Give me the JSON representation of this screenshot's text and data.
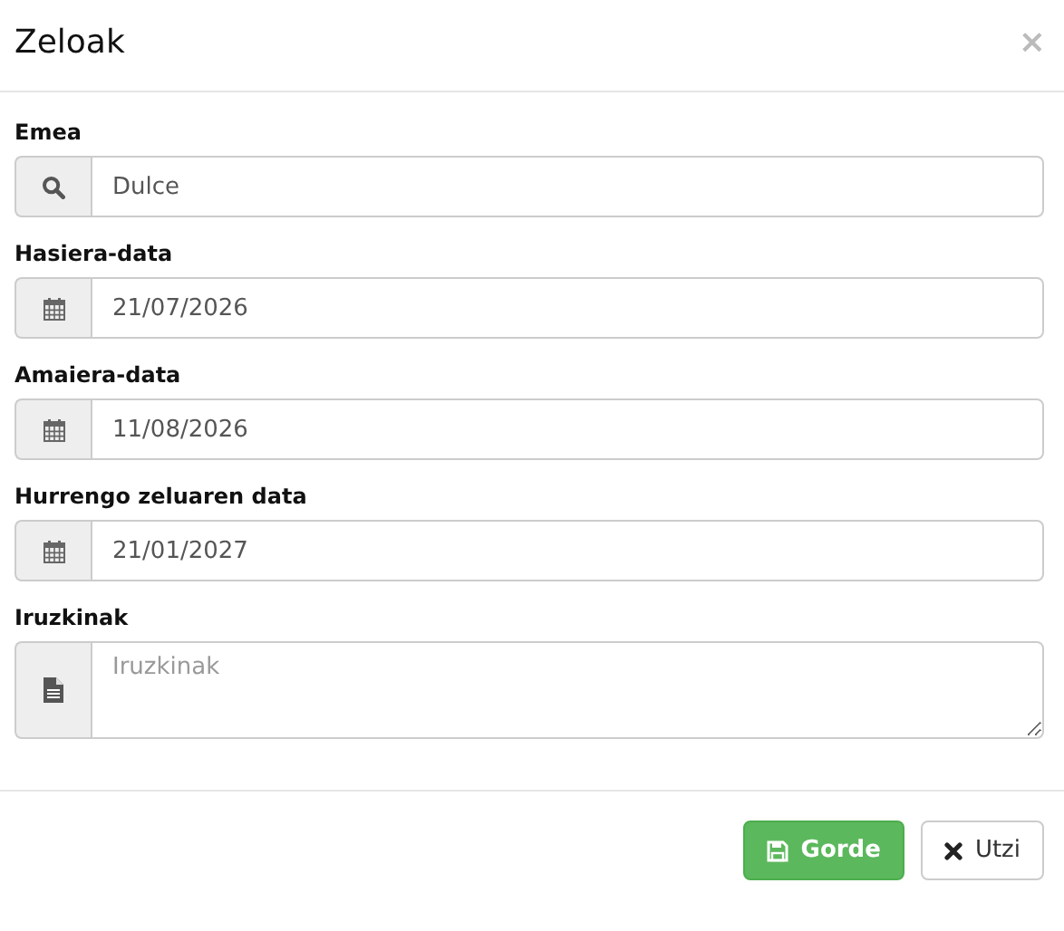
{
  "dialog": {
    "title": "Zeloak",
    "close": "×"
  },
  "fields": [
    {
      "kind": "search",
      "label": "Emea",
      "value": "Dulce"
    },
    {
      "kind": "date",
      "label": "Hasiera-data",
      "value": "21/07/2026"
    },
    {
      "kind": "date",
      "label": "Amaiera-data",
      "value": "11/08/2026"
    },
    {
      "kind": "date",
      "label": "Hurrengo zeluaren data",
      "value": "21/01/2027"
    },
    {
      "kind": "textarea",
      "label": "Iruzkinak",
      "placeholder": "Iruzkinak"
    }
  ],
  "buttons": [
    {
      "kind": "save",
      "label": "Gorde"
    },
    {
      "kind": "cancel",
      "label": "Utzi"
    }
  ]
}
